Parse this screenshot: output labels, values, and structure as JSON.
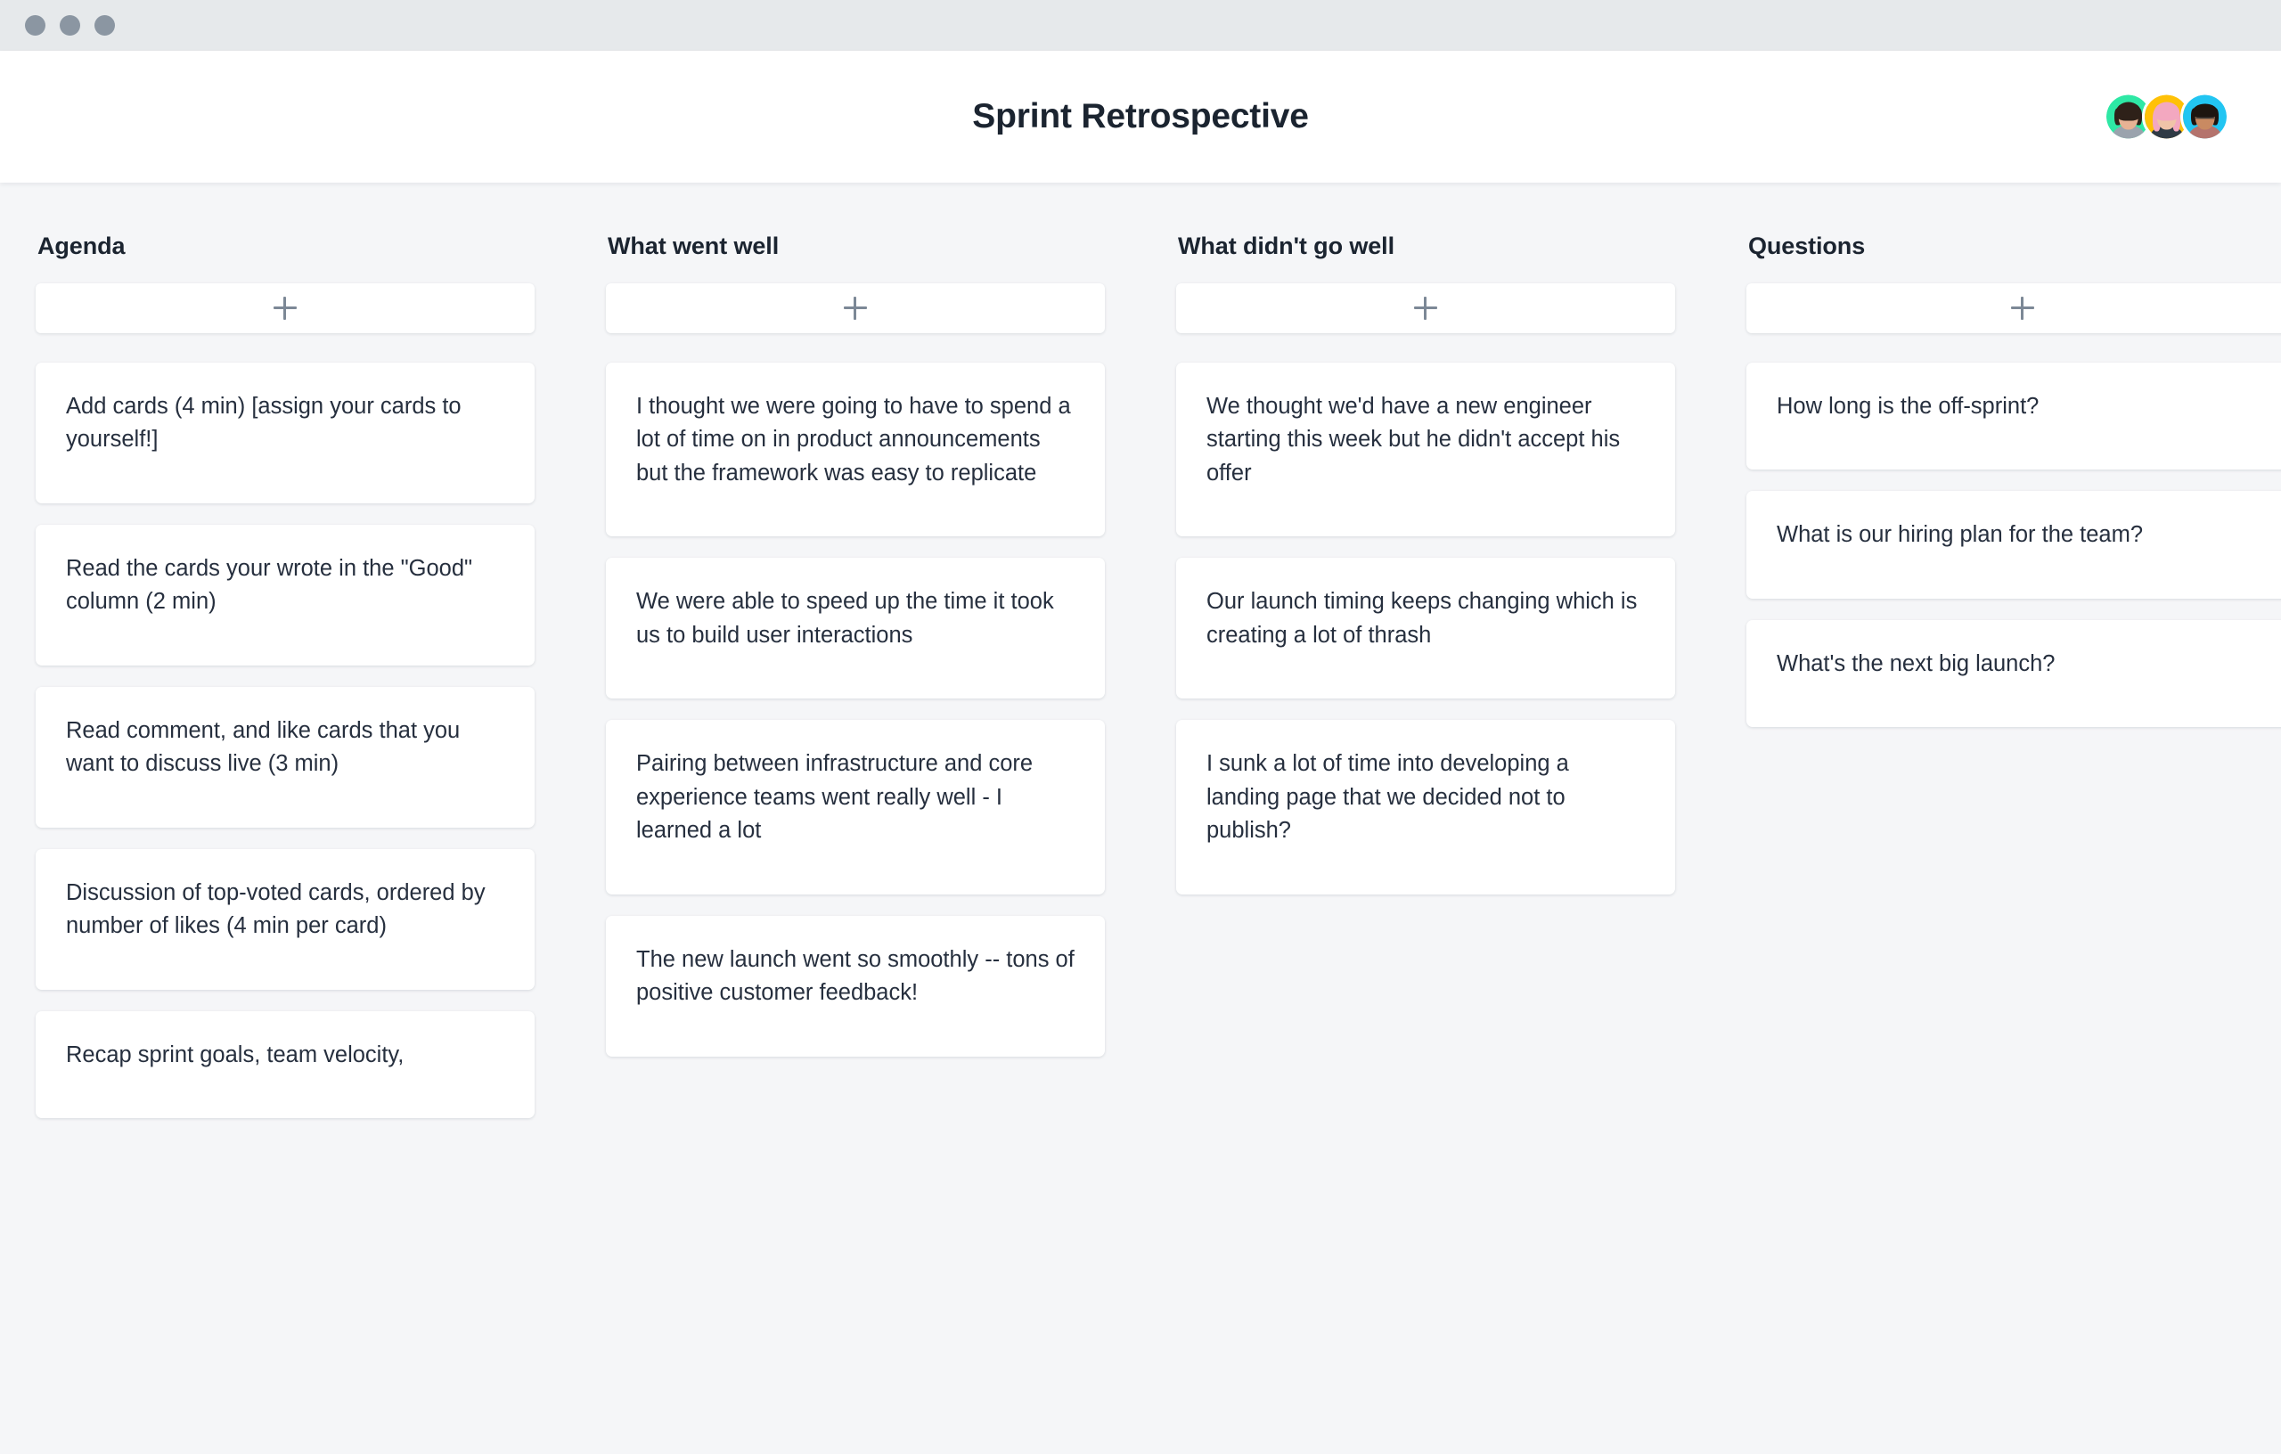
{
  "window": {
    "traffic_lights": [
      "close-dot",
      "minimize-dot",
      "maximize-dot"
    ]
  },
  "header": {
    "title": "Sprint Retrospective",
    "members": [
      {
        "name": "member-avatar-green",
        "theme": "theme-green"
      },
      {
        "name": "member-avatar-gold",
        "theme": "theme-gold"
      },
      {
        "name": "member-avatar-cyan",
        "theme": "theme-cyan"
      }
    ]
  },
  "board": {
    "add_card_icon": "plus-icon",
    "columns": [
      {
        "id": "agenda",
        "title": "Agenda",
        "cards": [
          {
            "text": "Add cards (4 min) [assign your cards to yourself!]",
            "avatar": "theme-gold"
          },
          {
            "text": "Read the cards your wrote in the \"Good\" column (2 min)",
            "avatar": "theme-green"
          },
          {
            "text": "Read comment, and like cards that you want to discuss live (3 min)",
            "avatar": "theme-cyan"
          },
          {
            "text": "Discussion of top-voted cards, ordered by number of likes (4 min per card)",
            "avatar": "theme-cyan"
          },
          {
            "text": "Recap sprint goals, team velocity,",
            "avatar": "theme-green"
          }
        ]
      },
      {
        "id": "what-went-well",
        "title": "What went well",
        "cards": [
          {
            "text": "I thought we were going to have to spend a lot of time on in product announcements but the framework was easy to replicate",
            "avatar": "theme-gold"
          },
          {
            "text": "We were able to speed up the time it took us to build user interactions",
            "avatar": "theme-cyan"
          },
          {
            "text": "Pairing between infrastructure and core experience teams went really well - I learned a lot",
            "avatar": "theme-green"
          },
          {
            "text": "The new launch went so smoothly -- tons of positive customer feedback!",
            "avatar": "theme-gold"
          }
        ]
      },
      {
        "id": "what-didnt-go-well",
        "title": "What didn't go well",
        "cards": [
          {
            "text": "We thought we'd have a new engineer starting this week but he didn't accept his offer",
            "avatar": "theme-green"
          },
          {
            "text": "Our launch timing keeps changing which is creating a lot of thrash",
            "avatar": "theme-green"
          },
          {
            "text": "I sunk a lot of time into developing a landing page that we decided not to publish?",
            "avatar": "theme-gold"
          }
        ]
      },
      {
        "id": "questions",
        "title": "Questions",
        "cards": [
          {
            "text": "How long is the off-sprint?",
            "avatar": "theme-gold"
          },
          {
            "text": "What is our hiring plan for the team?",
            "avatar": "theme-green"
          },
          {
            "text": "What's the next big launch?",
            "avatar": "theme-cyan"
          }
        ]
      }
    ]
  },
  "colors": {
    "page_background": "#f5f6f8",
    "chrome_background": "#e6e9eb",
    "header_background": "#ffffff",
    "card_background": "#ffffff",
    "text_primary": "#1b2430",
    "text_card": "#262f3e",
    "icon_muted": "#7c8896",
    "avatar_green": "#2ee8a5",
    "avatar_gold": "#ffc107",
    "avatar_cyan": "#22c5f2"
  }
}
